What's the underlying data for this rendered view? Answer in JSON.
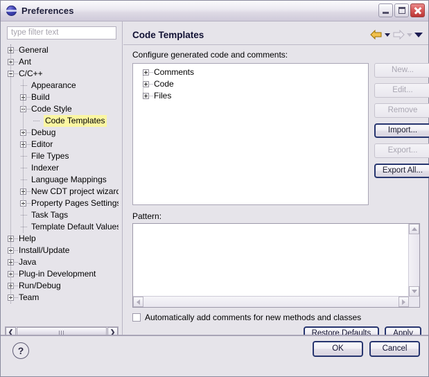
{
  "window": {
    "title": "Preferences",
    "icon": "eclipse-globe-icon",
    "minimize_label": "Minimize",
    "maximize_label": "Maximize",
    "close_label": "Close"
  },
  "sidebar": {
    "filter_placeholder": "type filter text",
    "filter_value": "",
    "tree": [
      {
        "label": "General",
        "depth": 0,
        "state": "collapsed"
      },
      {
        "label": "Ant",
        "depth": 0,
        "state": "collapsed"
      },
      {
        "label": "C/C++",
        "depth": 0,
        "state": "expanded"
      },
      {
        "label": "Appearance",
        "depth": 1,
        "state": "leaf"
      },
      {
        "label": "Build",
        "depth": 1,
        "state": "collapsed"
      },
      {
        "label": "Code Style",
        "depth": 1,
        "state": "expanded"
      },
      {
        "label": "Code Templates",
        "depth": 2,
        "state": "leaf",
        "selected": true
      },
      {
        "label": "Debug",
        "depth": 1,
        "state": "collapsed"
      },
      {
        "label": "Editor",
        "depth": 1,
        "state": "collapsed"
      },
      {
        "label": "File Types",
        "depth": 1,
        "state": "leaf"
      },
      {
        "label": "Indexer",
        "depth": 1,
        "state": "leaf"
      },
      {
        "label": "Language Mappings",
        "depth": 1,
        "state": "leaf"
      },
      {
        "label": "New CDT project wizard",
        "depth": 1,
        "state": "collapsed"
      },
      {
        "label": "Property Pages Settings",
        "depth": 1,
        "state": "collapsed"
      },
      {
        "label": "Task Tags",
        "depth": 1,
        "state": "leaf"
      },
      {
        "label": "Template Default Values",
        "depth": 1,
        "state": "leaf"
      },
      {
        "label": "Help",
        "depth": 0,
        "state": "collapsed"
      },
      {
        "label": "Install/Update",
        "depth": 0,
        "state": "collapsed"
      },
      {
        "label": "Java",
        "depth": 0,
        "state": "collapsed"
      },
      {
        "label": "Plug-in Development",
        "depth": 0,
        "state": "collapsed"
      },
      {
        "label": "Run/Debug",
        "depth": 0,
        "state": "collapsed"
      },
      {
        "label": "Team",
        "depth": 0,
        "state": "collapsed"
      }
    ],
    "scroll_left_icon": "chevron-left-icon",
    "scroll_right_icon": "chevron-right-icon"
  },
  "main": {
    "title": "Code Templates",
    "nav": {
      "back_icon": "back-arrow-icon",
      "back_menu_icon": "caret-down-icon",
      "forward_icon": "forward-arrow-icon",
      "forward_menu_icon": "caret-down-icon",
      "menu_icon": "caret-down-icon"
    },
    "description": "Configure generated code and comments:",
    "templates": [
      {
        "label": "Comments",
        "state": "collapsed"
      },
      {
        "label": "Code",
        "state": "collapsed"
      },
      {
        "label": "Files",
        "state": "collapsed"
      }
    ],
    "side_buttons": [
      {
        "label": "New...",
        "enabled": false,
        "default": false
      },
      {
        "label": "Edit...",
        "enabled": false,
        "default": false
      },
      {
        "label": "Remove",
        "enabled": false,
        "default": false
      },
      {
        "label": "Import...",
        "enabled": true,
        "default": true
      },
      {
        "label": "Export...",
        "enabled": false,
        "default": false
      },
      {
        "label": "Export All...",
        "enabled": true,
        "default": true
      }
    ],
    "pattern_label": "Pattern:",
    "pattern_value": "",
    "checkbox": {
      "label": "Automatically add comments for new methods and classes",
      "checked": false
    },
    "restore_defaults_label": "Restore Defaults",
    "apply_label": "Apply"
  },
  "footer": {
    "help_icon": "help-question-icon",
    "ok_label": "OK",
    "cancel_label": "Cancel"
  },
  "colors": {
    "selection_highlight": "#fbf6a2",
    "dialog_background": "#e6e4ea",
    "default_button_border": "#27356f",
    "back_arrow": "#e2a600"
  }
}
